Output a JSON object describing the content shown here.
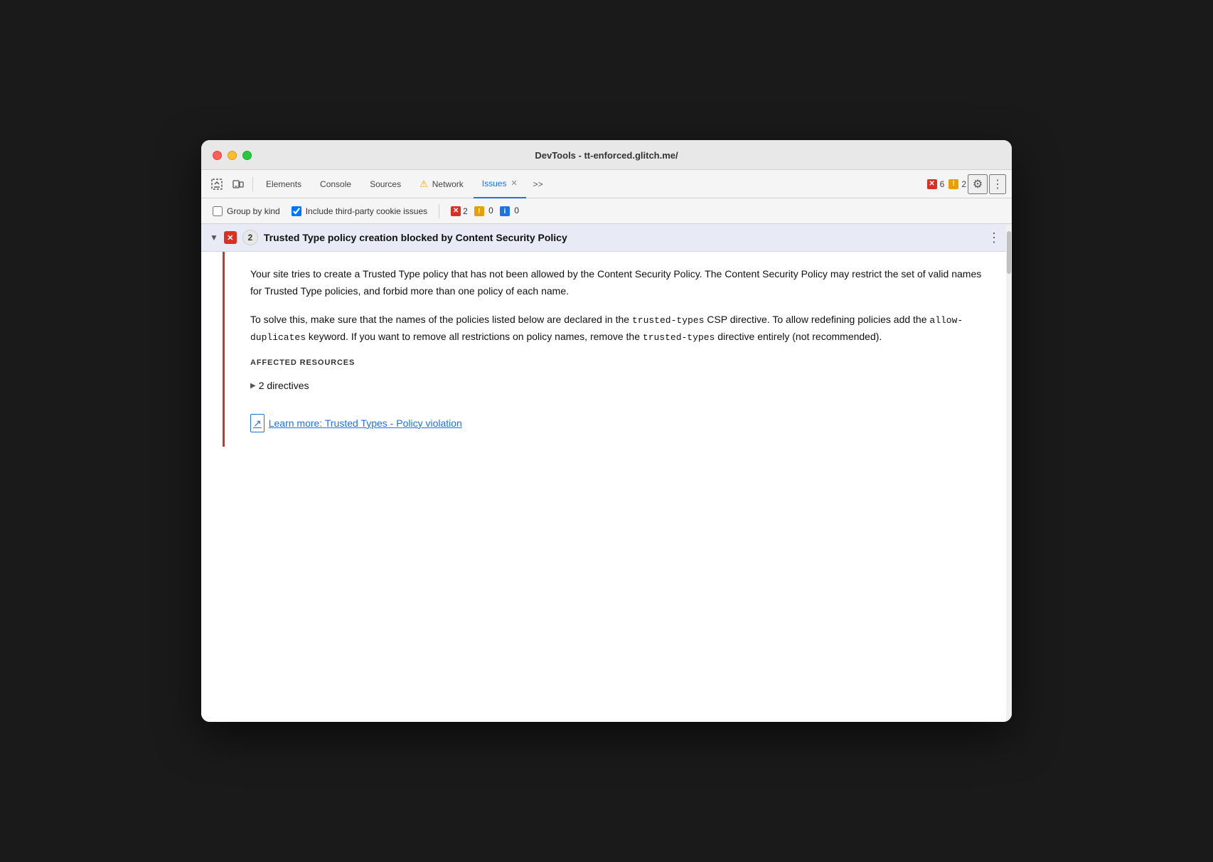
{
  "window": {
    "title": "DevTools - tt-enforced.glitch.me/"
  },
  "tabs": [
    {
      "id": "elements",
      "label": "Elements",
      "active": false
    },
    {
      "id": "console",
      "label": "Console",
      "active": false
    },
    {
      "id": "sources",
      "label": "Sources",
      "active": false
    },
    {
      "id": "network",
      "label": "Network",
      "active": false,
      "has_warning": true
    },
    {
      "id": "issues",
      "label": "Issues",
      "active": true,
      "has_close": true
    }
  ],
  "toolbar": {
    "more_tabs_label": ">>",
    "error_count": "6",
    "warning_count": "2"
  },
  "secondary_toolbar": {
    "group_by_kind_label": "Group by kind",
    "include_third_party_label": "Include third-party cookie issues",
    "error_count": "2",
    "warning_count": "0",
    "info_count": "0"
  },
  "issue": {
    "count": "2",
    "title": "Trusted Type policy creation blocked by Content Security Policy",
    "description_1": "Your site tries to create a Trusted Type policy that has not been allowed by the Content Security Policy. The Content Security Policy may restrict the set of valid names for Trusted Type policies, and forbid more than one policy of each name.",
    "description_2_part1": "To solve this, make sure that the names of the policies listed below are declared in the ",
    "description_2_code1": "trusted-types",
    "description_2_part2": " CSP directive. To allow redefining policies add the ",
    "description_2_code2": "allow-\nduplicates",
    "description_2_part3": " keyword. If you want to remove all restrictions on policy names, remove the ",
    "description_2_code3": "trusted-types",
    "description_2_part4": " directive entirely (not recommended).",
    "affected_resources_label": "AFFECTED RESOURCES",
    "directives_label": "2 directives",
    "learn_more_label": "Learn more: Trusted Types - Policy violation"
  }
}
